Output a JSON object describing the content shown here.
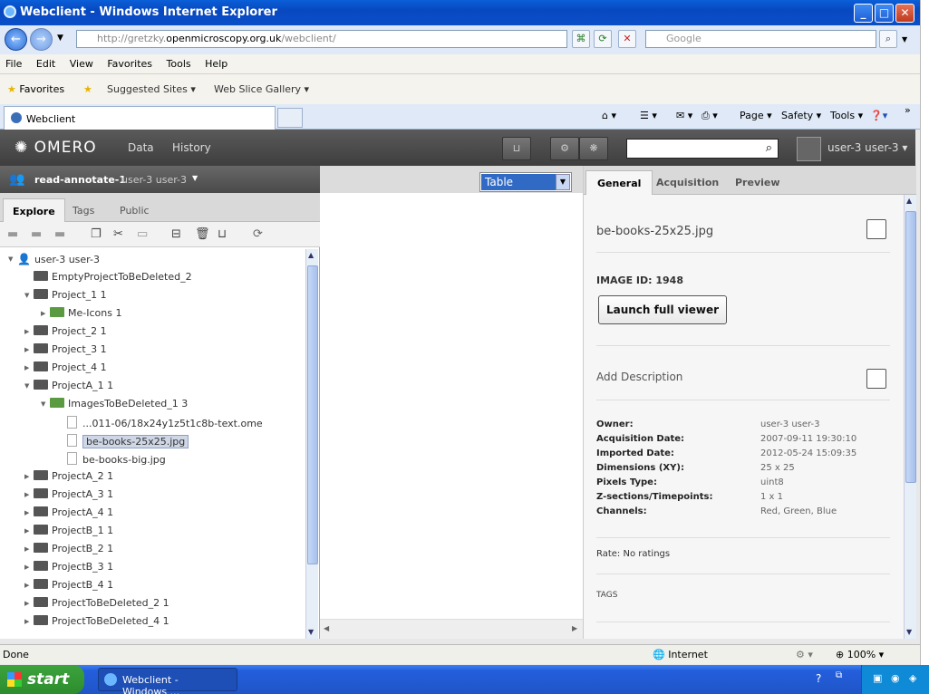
{
  "browser": {
    "title": "Webclient - Windows Internet Explorer",
    "url_prefix": "http://gretzky.",
    "url_host": "openmicroscopy.org.uk",
    "url_path": "/webclient/",
    "search_placeholder": "Google",
    "menu": [
      "File",
      "Edit",
      "View",
      "Favorites",
      "Tools",
      "Help"
    ],
    "favorites_label": "Favorites",
    "suggested_sites": "Suggested Sites",
    "web_slice": "Web Slice Gallery",
    "tab_title": "Webclient",
    "cmd": {
      "page": "Page",
      "safety": "Safety",
      "tools": "Tools"
    },
    "status": "Done",
    "zone": "Internet",
    "zoom": "100%"
  },
  "omero": {
    "logo": "OMERO",
    "nav": {
      "data": "Data",
      "history": "History"
    },
    "user": "user-3 user-3"
  },
  "left": {
    "group_name": "read-annotate-1",
    "group_user": "user-3 user-3",
    "tabs": [
      "Explore",
      "Tags",
      "Public"
    ],
    "tree": [
      {
        "label": "user-3 user-3",
        "kind": "user",
        "depth": 0,
        "arrow": "open"
      },
      {
        "label": "EmptyProjectToBeDeleted_2",
        "kind": "folder",
        "depth": 1,
        "arrow": ""
      },
      {
        "label": "Project_1  1",
        "kind": "folder",
        "depth": 1,
        "arrow": "open"
      },
      {
        "label": "Me-Icons  1",
        "kind": "dataset",
        "depth": 2,
        "arrow": "closed"
      },
      {
        "label": "Project_2  1",
        "kind": "folder",
        "depth": 1,
        "arrow": "closed"
      },
      {
        "label": "Project_3  1",
        "kind": "folder",
        "depth": 1,
        "arrow": "closed"
      },
      {
        "label": "Project_4  1",
        "kind": "folder",
        "depth": 1,
        "arrow": "closed"
      },
      {
        "label": "ProjectA_1  1",
        "kind": "folder",
        "depth": 1,
        "arrow": "open"
      },
      {
        "label": "ImagesToBeDeleted_1  3",
        "kind": "dataset",
        "depth": 2,
        "arrow": "open"
      },
      {
        "label": "...011-06/18x24y1z5t1c8b-text.ome",
        "kind": "image",
        "depth": 3,
        "arrow": ""
      },
      {
        "label": "be-books-25x25.jpg",
        "kind": "image",
        "depth": 3,
        "arrow": "",
        "selected": true
      },
      {
        "label": "be-books-big.jpg",
        "kind": "image",
        "depth": 3,
        "arrow": ""
      },
      {
        "label": "ProjectA_2  1",
        "kind": "folder",
        "depth": 1,
        "arrow": "closed"
      },
      {
        "label": "ProjectA_3  1",
        "kind": "folder",
        "depth": 1,
        "arrow": "closed"
      },
      {
        "label": "ProjectA_4  1",
        "kind": "folder",
        "depth": 1,
        "arrow": "closed"
      },
      {
        "label": "ProjectB_1  1",
        "kind": "folder",
        "depth": 1,
        "arrow": "closed"
      },
      {
        "label": "ProjectB_2  1",
        "kind": "folder",
        "depth": 1,
        "arrow": "closed"
      },
      {
        "label": "ProjectB_3  1",
        "kind": "folder",
        "depth": 1,
        "arrow": "closed"
      },
      {
        "label": "ProjectB_4  1",
        "kind": "folder",
        "depth": 1,
        "arrow": "closed"
      },
      {
        "label": "ProjectToBeDeleted_2  1",
        "kind": "folder",
        "depth": 1,
        "arrow": "closed"
      },
      {
        "label": "ProjectToBeDeleted_4  1",
        "kind": "folder",
        "depth": 1,
        "arrow": "closed"
      }
    ]
  },
  "center": {
    "view": "Table"
  },
  "right": {
    "tabs": [
      "General",
      "Acquisition",
      "Preview"
    ],
    "image_name": "be-books-25x25.jpg",
    "image_id": "IMAGE ID: 1948",
    "launch": "Launch full viewer",
    "add_description": "Add Description",
    "meta": [
      {
        "k": "Owner:",
        "v": "user-3 user-3"
      },
      {
        "k": "Acquisition Date:",
        "v": "2007-09-11 19:30:10"
      },
      {
        "k": "Imported Date:",
        "v": "2012-05-24 15:09:35"
      },
      {
        "k": "Dimensions (XY):",
        "v": "25 x 25"
      },
      {
        "k": "Pixels Type:",
        "v": "uint8"
      },
      {
        "k": "Z-sections/Timepoints:",
        "v": "1 x 1"
      },
      {
        "k": "Channels:",
        "v": "Red, Green, Blue"
      }
    ],
    "rating": "Rate: No ratings",
    "tags": "TAGS"
  },
  "taskbar": {
    "start": "start",
    "item": "Webclient - Windows ..."
  }
}
